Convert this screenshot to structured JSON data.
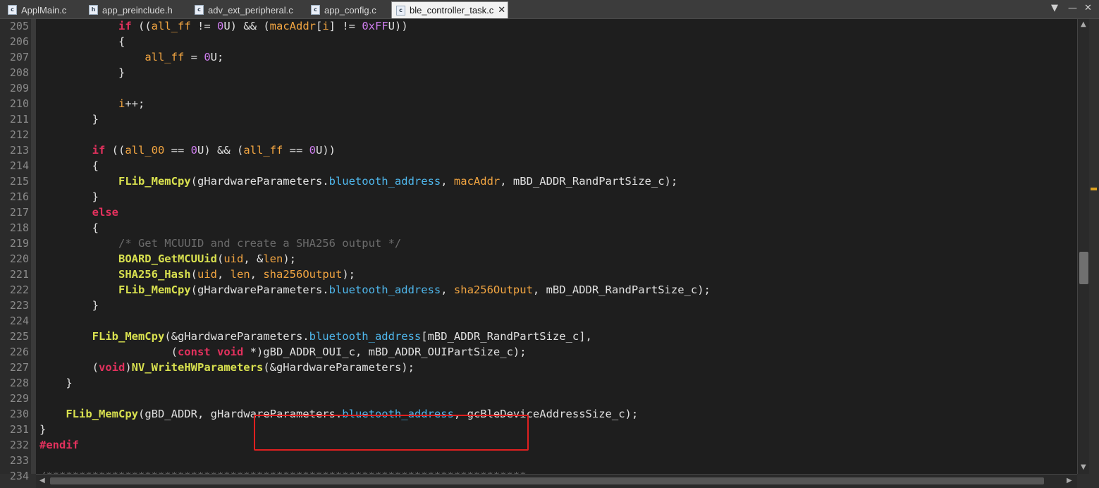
{
  "tabs": [
    {
      "icon": "c",
      "label": "ApplMain.c",
      "active": false
    },
    {
      "icon": "h",
      "label": "app_preinclude.h",
      "active": false
    },
    {
      "icon": "c",
      "label": "adv_ext_peripheral.c",
      "active": false
    },
    {
      "icon": "c",
      "label": "app_config.c",
      "active": false
    },
    {
      "icon": "c",
      "label": "ble_controller_task.c",
      "active": true
    }
  ],
  "tab_close_glyph": "✕",
  "window_controls": {
    "restore": "▼",
    "minimize": "—",
    "close": "✕"
  },
  "lines": [
    {
      "n": "205",
      "code": [
        {
          "t": "            "
        },
        {
          "t": "if",
          "c": "kw"
        },
        {
          "t": " (("
        },
        {
          "t": "all_ff",
          "c": "var"
        },
        {
          "t": " != "
        },
        {
          "t": "0",
          "c": "num"
        },
        {
          "t": "U) && ("
        },
        {
          "t": "macAddr",
          "c": "var"
        },
        {
          "t": "["
        },
        {
          "t": "i",
          "c": "var"
        },
        {
          "t": "] != "
        },
        {
          "t": "0xFF",
          "c": "num"
        },
        {
          "t": "U))"
        }
      ]
    },
    {
      "n": "206",
      "code": [
        {
          "t": "            {"
        }
      ]
    },
    {
      "n": "207",
      "code": [
        {
          "t": "                "
        },
        {
          "t": "all_ff",
          "c": "var"
        },
        {
          "t": " = "
        },
        {
          "t": "0",
          "c": "num"
        },
        {
          "t": "U;"
        }
      ]
    },
    {
      "n": "208",
      "code": [
        {
          "t": "            }"
        }
      ]
    },
    {
      "n": "209",
      "code": []
    },
    {
      "n": "210",
      "code": [
        {
          "t": "            "
        },
        {
          "t": "i",
          "c": "var"
        },
        {
          "t": "++;"
        }
      ]
    },
    {
      "n": "211",
      "code": [
        {
          "t": "        }"
        }
      ]
    },
    {
      "n": "212",
      "code": []
    },
    {
      "n": "213",
      "code": [
        {
          "t": "        "
        },
        {
          "t": "if",
          "c": "kw"
        },
        {
          "t": " (("
        },
        {
          "t": "all_00",
          "c": "var"
        },
        {
          "t": " == "
        },
        {
          "t": "0",
          "c": "num"
        },
        {
          "t": "U) && ("
        },
        {
          "t": "all_ff",
          "c": "var"
        },
        {
          "t": " == "
        },
        {
          "t": "0",
          "c": "num"
        },
        {
          "t": "U))"
        }
      ]
    },
    {
      "n": "214",
      "code": [
        {
          "t": "        {"
        }
      ]
    },
    {
      "n": "215",
      "code": [
        {
          "t": "            "
        },
        {
          "t": "FLib_MemCpy",
          "c": "fn"
        },
        {
          "t": "(gHardwareParameters."
        },
        {
          "t": "bluetooth_address",
          "c": "mem"
        },
        {
          "t": ", "
        },
        {
          "t": "macAddr",
          "c": "var"
        },
        {
          "t": ", mBD_ADDR_RandPartSize_c);"
        }
      ]
    },
    {
      "n": "216",
      "code": [
        {
          "t": "        }"
        }
      ]
    },
    {
      "n": "217",
      "code": [
        {
          "t": "        "
        },
        {
          "t": "else",
          "c": "kw"
        }
      ]
    },
    {
      "n": "218",
      "code": [
        {
          "t": "        {"
        }
      ]
    },
    {
      "n": "219",
      "code": [
        {
          "t": "            "
        },
        {
          "t": "/* Get MCUUID and create a SHA256 output */",
          "c": "cmt"
        }
      ]
    },
    {
      "n": "220",
      "code": [
        {
          "t": "            "
        },
        {
          "t": "BOARD_GetMCUUid",
          "c": "fn"
        },
        {
          "t": "("
        },
        {
          "t": "uid",
          "c": "var"
        },
        {
          "t": ", &"
        },
        {
          "t": "len",
          "c": "var"
        },
        {
          "t": ");"
        }
      ]
    },
    {
      "n": "221",
      "code": [
        {
          "t": "            "
        },
        {
          "t": "SHA256_Hash",
          "c": "fn"
        },
        {
          "t": "("
        },
        {
          "t": "uid",
          "c": "var"
        },
        {
          "t": ", "
        },
        {
          "t": "len",
          "c": "var"
        },
        {
          "t": ", "
        },
        {
          "t": "sha256Output",
          "c": "var"
        },
        {
          "t": ");"
        }
      ]
    },
    {
      "n": "222",
      "code": [
        {
          "t": "            "
        },
        {
          "t": "FLib_MemCpy",
          "c": "fn"
        },
        {
          "t": "(gHardwareParameters."
        },
        {
          "t": "bluetooth_address",
          "c": "mem"
        },
        {
          "t": ", "
        },
        {
          "t": "sha256Output",
          "c": "var"
        },
        {
          "t": ", mBD_ADDR_RandPartSize_c);"
        }
      ]
    },
    {
      "n": "223",
      "code": [
        {
          "t": "        }"
        }
      ]
    },
    {
      "n": "224",
      "code": []
    },
    {
      "n": "225",
      "code": [
        {
          "t": "        "
        },
        {
          "t": "FLib_MemCpy",
          "c": "fn"
        },
        {
          "t": "(&gHardwareParameters."
        },
        {
          "t": "bluetooth_address",
          "c": "mem"
        },
        {
          "t": "[mBD_ADDR_RandPartSize_c],"
        }
      ]
    },
    {
      "n": "226",
      "code": [
        {
          "t": "                    ("
        },
        {
          "t": "const",
          "c": "kw"
        },
        {
          "t": " "
        },
        {
          "t": "void",
          "c": "kw"
        },
        {
          "t": " *)gBD_ADDR_OUI_c, mBD_ADDR_OUIPartSize_c);"
        }
      ]
    },
    {
      "n": "227",
      "code": [
        {
          "t": "        ("
        },
        {
          "t": "void",
          "c": "kw"
        },
        {
          "t": ")"
        },
        {
          "t": "NV_WriteHWParameters",
          "c": "fn"
        },
        {
          "t": "(&gHardwareParameters);"
        }
      ]
    },
    {
      "n": "228",
      "code": [
        {
          "t": "    }"
        }
      ]
    },
    {
      "n": "229",
      "code": []
    },
    {
      "n": "230",
      "code": [
        {
          "t": "    "
        },
        {
          "t": "FLib_MemCpy",
          "c": "fn"
        },
        {
          "t": "(gBD_ADDR, gHardwareParameters."
        },
        {
          "t": "bluetooth_address",
          "c": "mem"
        },
        {
          "t": ", gcBleDeviceAddressSize_c);"
        }
      ]
    },
    {
      "n": "231",
      "code": [
        {
          "t": "}"
        }
      ]
    },
    {
      "n": "232",
      "code": [
        {
          "t": "#endif",
          "c": "kw"
        }
      ]
    },
    {
      "n": "233",
      "code": []
    },
    {
      "n": "234",
      "code": [
        {
          "t": "/*************************************************************************",
          "c": "cmt"
        }
      ]
    }
  ]
}
